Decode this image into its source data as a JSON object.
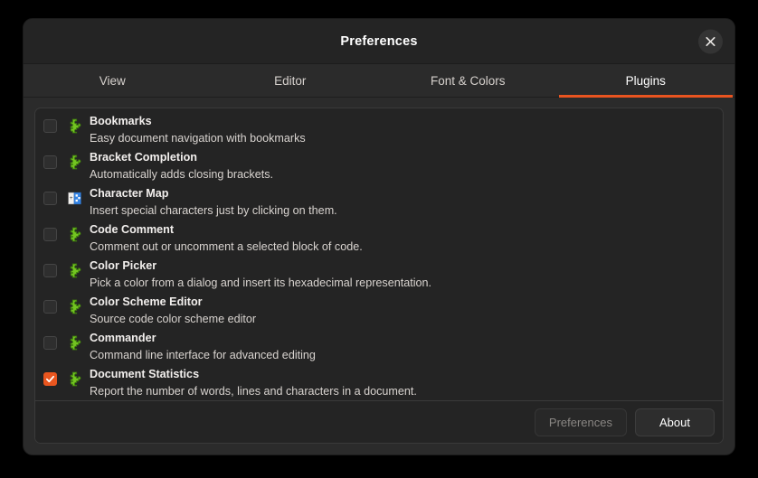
{
  "window": {
    "title": "Preferences",
    "close_icon": "close-icon",
    "accent_color": "#e95420",
    "background": "#2b2b2b"
  },
  "tabs": [
    {
      "label": "View",
      "active": false
    },
    {
      "label": "Editor",
      "active": false
    },
    {
      "label": "Font & Colors",
      "active": false
    },
    {
      "label": "Plugins",
      "active": true
    }
  ],
  "plugins": [
    {
      "name": "Bookmarks",
      "description": "Easy document navigation with bookmarks",
      "enabled": false,
      "icon": "puzzle-piece-icon"
    },
    {
      "name": "Bracket Completion",
      "description": "Automatically adds closing brackets.",
      "enabled": false,
      "icon": "puzzle-piece-icon"
    },
    {
      "name": "Character Map",
      "description": "Insert special characters just by clicking on them.",
      "enabled": false,
      "icon": "character-map-icon"
    },
    {
      "name": "Code Comment",
      "description": "Comment out or uncomment a selected block of code.",
      "enabled": false,
      "icon": "puzzle-piece-icon"
    },
    {
      "name": "Color Picker",
      "description": "Pick a color from a dialog and insert its hexadecimal representation.",
      "enabled": false,
      "icon": "puzzle-piece-icon"
    },
    {
      "name": "Color Scheme Editor",
      "description": "Source code color scheme editor",
      "enabled": false,
      "icon": "puzzle-piece-icon"
    },
    {
      "name": "Commander",
      "description": "Command line interface for advanced editing",
      "enabled": false,
      "icon": "puzzle-piece-icon"
    },
    {
      "name": "Document Statistics",
      "description": "Report the number of words, lines and characters in a document.",
      "enabled": true,
      "icon": "puzzle-piece-icon"
    }
  ],
  "actions": {
    "preferences_label": "Preferences",
    "preferences_enabled": false,
    "about_label": "About",
    "about_enabled": true
  }
}
